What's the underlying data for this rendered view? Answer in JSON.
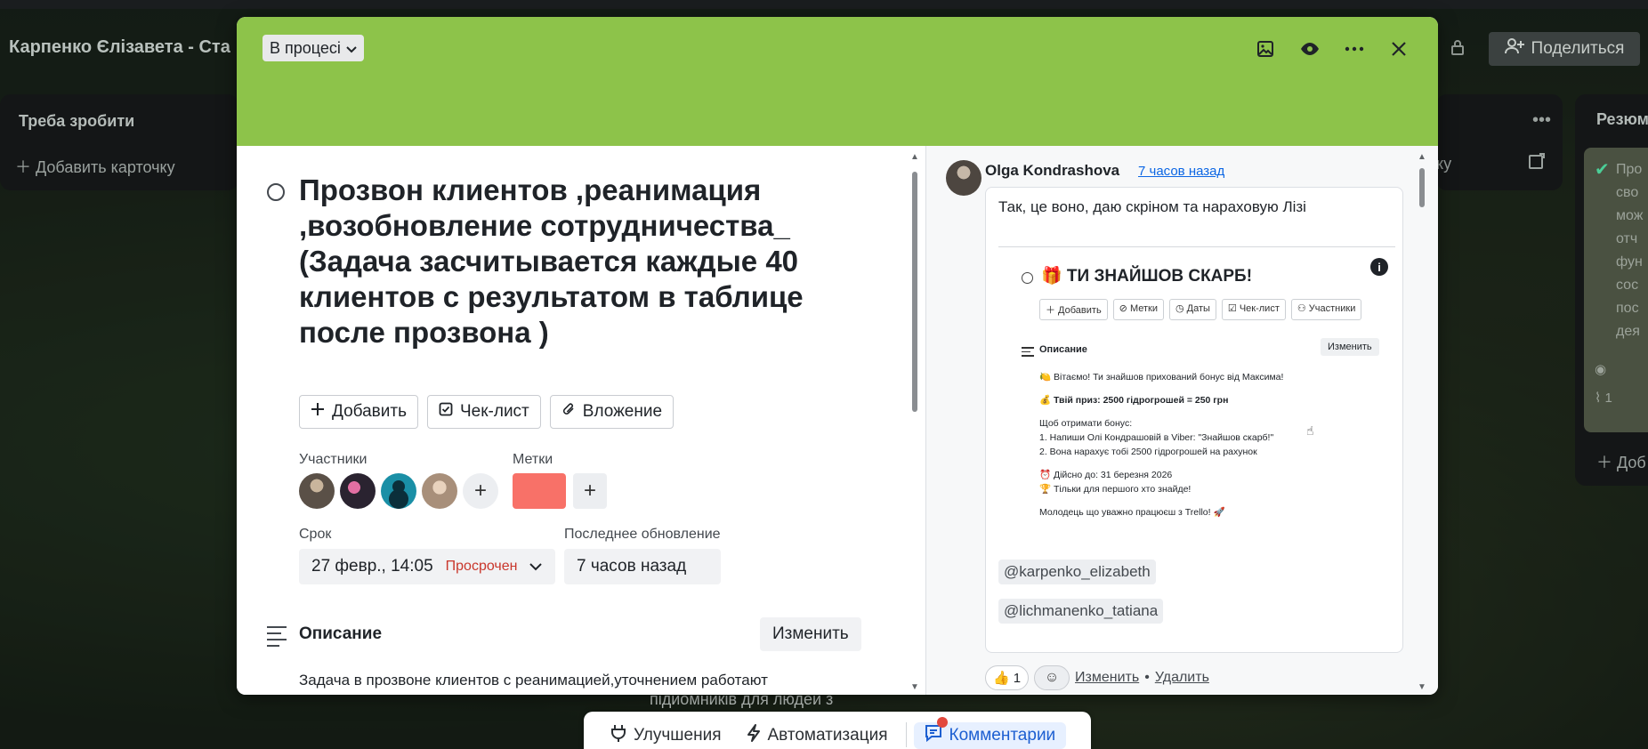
{
  "board": {
    "title": "Карпенко Єлізавета - Ста",
    "share_label": "Поделиться",
    "lists": {
      "todo": {
        "title": "Треба зробити",
        "add_card": "Добавить карточку"
      },
      "right": {
        "add_fragment": "ку"
      },
      "resume": {
        "title": "Резюм",
        "card_lines": [
          "Про",
          "сво",
          "мож",
          "отч",
          "фун",
          "сос",
          "пос",
          "дея"
        ],
        "card_count": "1",
        "add_label": "Доб"
      }
    },
    "background_text": "підйомників для людей з"
  },
  "bottom_bar": {
    "items": [
      {
        "label": "Улучшения",
        "icon": "plug-icon"
      },
      {
        "label": "Автоматизация",
        "icon": "lightning-icon"
      },
      {
        "label": "Комментарии",
        "icon": "comment-icon",
        "active": true
      }
    ]
  },
  "modal": {
    "status": "В процесі",
    "cover_color": "#8dc34a",
    "card": {
      "title": "Прозвон клиентов ,реанимация ,возобновление сотрудничества_ (Задача засчитывается каждые 40 клиентов с результатом в таблице после прозвона )",
      "actions": {
        "add": "Добавить",
        "checklist": "Чек-лист",
        "attachment": "Вложение"
      },
      "members_label": "Участники",
      "labels_label": "Метки",
      "label_color": "#f87168",
      "due_label": "Срок",
      "due_value": "27 февр., 14:05",
      "due_status": "Просрочен",
      "last_update_label": "Последнее обновление",
      "last_update_value": "7 часов назад",
      "description_title": "Описание",
      "edit_label": "Изменить",
      "description_text": "Задача в прозвоне клиентов с реанимацией,уточнением работают ли,предлодением просчета уникальных цен,задача максимально"
    },
    "comment": {
      "author": "Olga Kondrashova",
      "time": "7 часов назад",
      "text": "Так, це воно, даю скріном та нараховую Лізі",
      "screenshot": {
        "title": "🎁 ТИ ЗНАЙШОВ СКАРБ!",
        "chips": [
          "＋ Добавить",
          "⊘ Метки",
          "◷ Даты",
          "☑ Чек-лист",
          "⚇ Участники"
        ],
        "desc_title": "Описание",
        "edit_label": "Изменить",
        "lines": [
          "🍋 Вітаємо! Ти знайшов прихований бонус від Максима!",
          "",
          "💰 Твій приз: 2500 гідрогрошей = 250 грн",
          "",
          "Щоб отримати бонус:",
          "  1. Напиши Олі Кондрашовій в Viber: \"Знайшов скарб!\"",
          "  2. Вона нарахує тобі 2500 гідрогрошей на рахунок",
          "",
          "⏰ Дійсно до: 31 березня 2026",
          "🏆 Тільки для першого хто знайде!",
          "",
          "Молодець що уважно працюєш з Trello! 🚀"
        ]
      },
      "mentions": [
        "@karpenko_elizabeth",
        "@lichmanenko_tatiana"
      ],
      "reaction_emoji": "👍",
      "reaction_count": "1",
      "edit_link": "Изменить",
      "separator": "•",
      "delete_link": "Удалить"
    }
  }
}
